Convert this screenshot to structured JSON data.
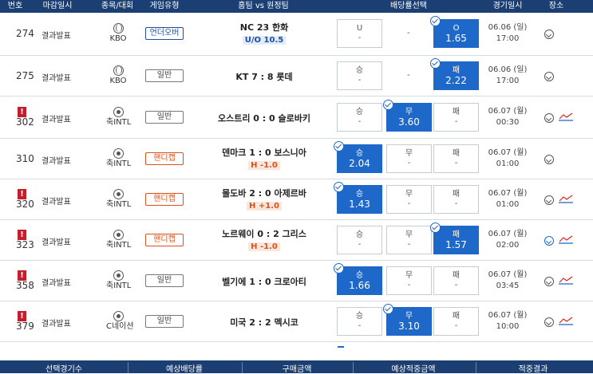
{
  "header": {
    "cols": [
      "번호",
      "마감일시",
      "종목/대회",
      "게임유형",
      "홈팀 vs 원정팀",
      "배당률선택",
      "경기일시",
      "장소"
    ]
  },
  "colors": {
    "header_bg": "#1b3f72",
    "selected_bg": "#1d68c8",
    "alert": "#c41e2a",
    "handicap": "#d9531e",
    "overunder": "#1e4fa3"
  },
  "rows": [
    {
      "num": "274",
      "alert": false,
      "deadline": "결과발표",
      "sport_icon": "baseball-icon",
      "league": "KBO",
      "type": "언더오버",
      "type_style": "blue",
      "match": "NC  23  한화",
      "sub": "U/O 10.5",
      "sub_style": "blue",
      "odds": [
        {
          "label": "U",
          "value": "-",
          "selected": false
        },
        {
          "label": "",
          "value": "-",
          "selected": false
        },
        {
          "label": "O",
          "value": "1.65",
          "selected": true
        }
      ],
      "date": "06.06 (일)",
      "time": "17:00",
      "trend": false
    },
    {
      "num": "275",
      "alert": false,
      "deadline": "결과발표",
      "sport_icon": "baseball-icon",
      "league": "KBO",
      "type": "일반",
      "type_style": "gray",
      "match": "KT 7 : 8 롯데",
      "sub": "",
      "sub_style": "",
      "odds": [
        {
          "label": "승",
          "value": "-",
          "selected": false
        },
        {
          "label": "",
          "value": "-",
          "selected": false
        },
        {
          "label": "패",
          "value": "2.22",
          "selected": true
        }
      ],
      "date": "06.06 (일)",
      "time": "17:00",
      "trend": false
    },
    {
      "num": "302",
      "alert": true,
      "deadline": "결과발표",
      "sport_icon": "soccer-icon",
      "league": "축INTL",
      "type": "일반",
      "type_style": "gray",
      "match": "오스트리 0 : 0 슬로바키",
      "sub": "",
      "sub_style": "",
      "odds": [
        {
          "label": "승",
          "value": "-",
          "selected": false
        },
        {
          "label": "무",
          "value": "3.60",
          "selected": true
        },
        {
          "label": "패",
          "value": "-",
          "selected": false
        }
      ],
      "date": "06.07 (월)",
      "time": "00:30",
      "trend": true
    },
    {
      "num": "310",
      "alert": false,
      "deadline": "결과발표",
      "sport_icon": "soccer-icon",
      "league": "축INTL",
      "type": "핸디캡",
      "type_style": "orange",
      "match": "덴마크 1 : 0 보스니아",
      "sub": "H -1.0",
      "sub_style": "orange",
      "odds": [
        {
          "label": "승",
          "value": "2.04",
          "selected": true
        },
        {
          "label": "무",
          "value": "-",
          "selected": false
        },
        {
          "label": "패",
          "value": "-",
          "selected": false
        }
      ],
      "date": "06.07 (월)",
      "time": "01:00",
      "trend": false
    },
    {
      "num": "320",
      "alert": true,
      "deadline": "결과발표",
      "sport_icon": "soccer-icon",
      "league": "축INTL",
      "type": "핸디캡",
      "type_style": "orange",
      "match": "몰도바 2 : 0 아제르바",
      "sub": "H +1.0",
      "sub_style": "orange",
      "odds": [
        {
          "label": "승",
          "value": "1.43",
          "selected": true
        },
        {
          "label": "무",
          "value": "-",
          "selected": false
        },
        {
          "label": "패",
          "value": "-",
          "selected": false
        }
      ],
      "date": "06.07 (월)",
      "time": "01:00",
      "trend": true
    },
    {
      "num": "323",
      "alert": true,
      "deadline": "결과발표",
      "sport_icon": "soccer-icon",
      "league": "축INTL",
      "type": "핸디캡",
      "type_style": "orange",
      "match": "노르웨이 0 : 2 그리스",
      "sub": "H -1.0",
      "sub_style": "orange",
      "odds": [
        {
          "label": "승",
          "value": "-",
          "selected": false
        },
        {
          "label": "무",
          "value": "-",
          "selected": false
        },
        {
          "label": "패",
          "value": "1.57",
          "selected": true
        }
      ],
      "date": "06.07 (월)",
      "time": "02:00",
      "trend": true
    },
    {
      "num": "358",
      "alert": true,
      "deadline": "결과발표",
      "sport_icon": "soccer-icon",
      "league": "축INTL",
      "type": "일반",
      "type_style": "gray",
      "match": "벨기에 1 : 0 크로아티",
      "sub": "",
      "sub_style": "",
      "odds": [
        {
          "label": "승",
          "value": "1.66",
          "selected": true
        },
        {
          "label": "무",
          "value": "-",
          "selected": false
        },
        {
          "label": "패",
          "value": "-",
          "selected": false
        }
      ],
      "date": "06.07 (월)",
      "time": "03:45",
      "trend": true
    },
    {
      "num": "379",
      "alert": true,
      "deadline": "결과발표",
      "sport_icon": "soccer-icon",
      "league": "C네이션",
      "type": "일반",
      "type_style": "gray",
      "match": "미국 2 : 2 멕시코",
      "sub": "",
      "sub_style": "",
      "odds": [
        {
          "label": "승",
          "value": "-",
          "selected": false
        },
        {
          "label": "무",
          "value": "3.10",
          "selected": true
        },
        {
          "label": "패",
          "value": "-",
          "selected": false
        }
      ],
      "date": "06.07 (월)",
      "time": "10:00",
      "trend": true
    }
  ],
  "footer": {
    "cols": [
      "선택경기수",
      "예상배당률",
      "구매금액",
      "예상적중금액",
      "적중결과"
    ]
  }
}
